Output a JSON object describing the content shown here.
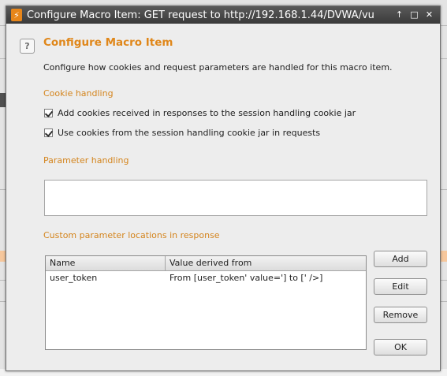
{
  "window": {
    "title": "Configure Macro Item: GET request to http://192.168.1.44/DVWA/vu",
    "app_icon": "burp-lightning-icon",
    "controls": {
      "pin": "↑",
      "maximize": "□",
      "close": "✕"
    }
  },
  "dialog": {
    "help_glyph": "?",
    "heading": "Configure Macro Item",
    "description": "Configure how cookies and request parameters are handled for this macro item."
  },
  "cookie_handling": {
    "label": "Cookie handling",
    "options": [
      {
        "label": "Add cookies received in responses to the session handling cookie jar",
        "checked": true
      },
      {
        "label": "Use cookies from the session handling cookie jar in requests",
        "checked": true
      }
    ]
  },
  "parameter_handling": {
    "label": "Parameter handling"
  },
  "custom_params": {
    "label": "Custom parameter locations in response",
    "columns": [
      "Name",
      "Value derived from"
    ],
    "rows": [
      {
        "name": "user_token",
        "value": "From [user_token' value='] to [' />]"
      }
    ],
    "buttons": {
      "add": "Add",
      "edit": "Edit",
      "remove": "Remove"
    }
  },
  "footer": {
    "ok": "OK"
  },
  "colors": {
    "accent": "#e0871a",
    "titlebar": "#3a3a3a"
  }
}
